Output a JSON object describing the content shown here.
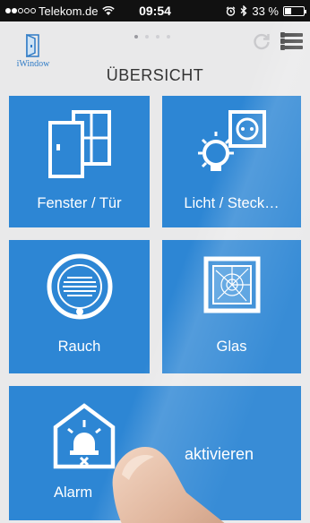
{
  "status_bar": {
    "carrier": "Telekom.de",
    "time": "09:54",
    "battery": "33 %",
    "battery_level": 0.33,
    "icons": [
      "signal-dots",
      "wifi-icon",
      "alarm-clock-icon",
      "bluetooth-icon",
      "battery-icon"
    ]
  },
  "header": {
    "logo_text": "iWindow",
    "title": "ÜBERSICHT",
    "page_dots": 4,
    "active_page": 1,
    "icons": [
      "refresh-icon",
      "menu-icon"
    ]
  },
  "tiles": [
    {
      "label": "Fenster / Tür",
      "icon": "door-window-icon"
    },
    {
      "label": "Licht / Steck…",
      "icon": "light-socket-icon"
    },
    {
      "label": "Rauch",
      "icon": "smoke-detector-icon"
    },
    {
      "label": "Glas",
      "icon": "broken-glass-icon"
    },
    {
      "label": "Alarm",
      "icon": "alarm-house-icon",
      "action": "aktivieren"
    }
  ],
  "colors": {
    "tile": "#2d86d4",
    "background": "#e9e9ea",
    "accent": "#2f7bc6"
  }
}
